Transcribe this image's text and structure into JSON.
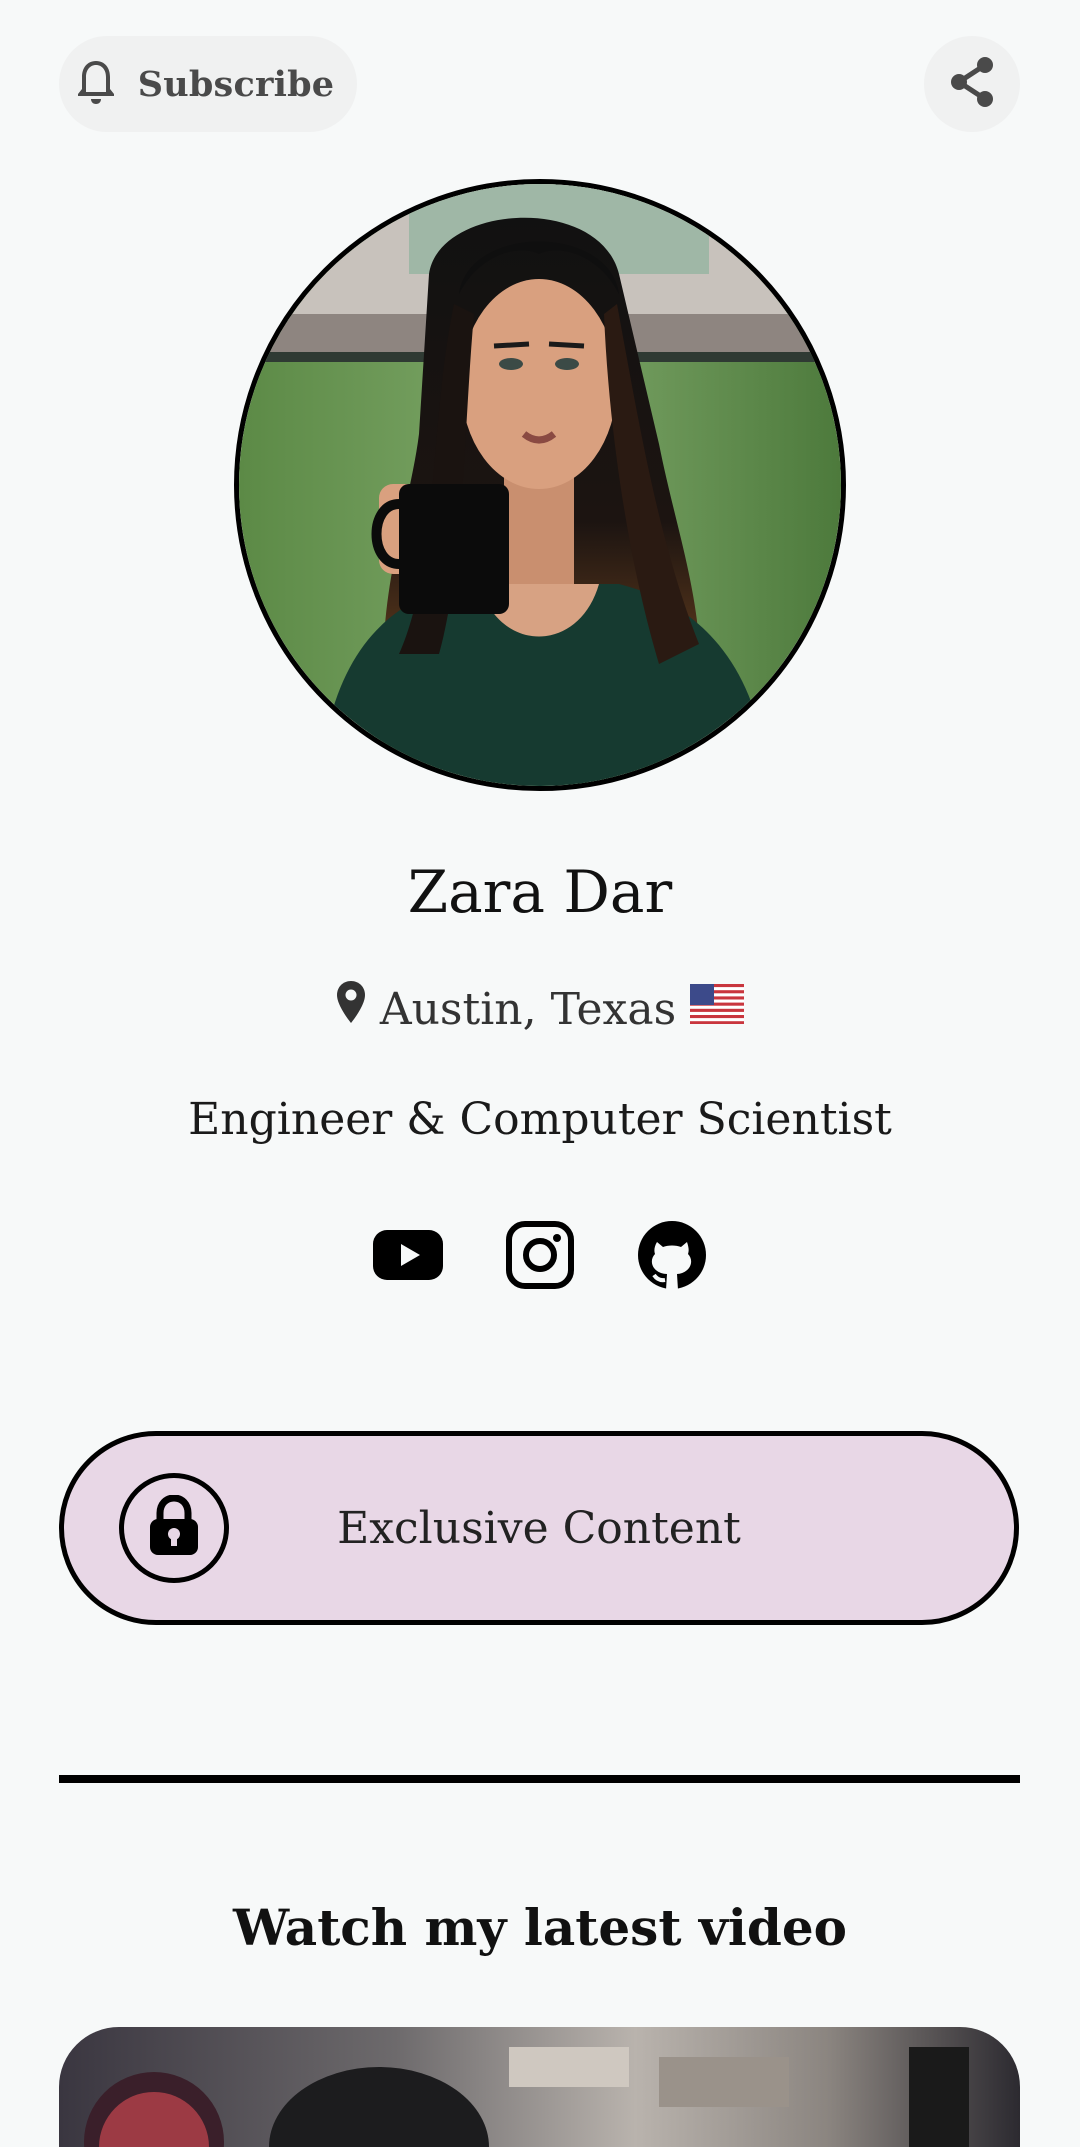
{
  "header": {
    "subscribe_label": "Subscribe",
    "subscribe_icon": "bell-icon",
    "share_icon": "share-icon"
  },
  "profile": {
    "name": "Zara Dar",
    "location": "Austin, Texas",
    "location_flag": "🇺🇸",
    "bio": "Engineer & Computer Scientist",
    "avatar_description": "profile photo"
  },
  "socials": [
    {
      "icon": "youtube-icon"
    },
    {
      "icon": "instagram-icon"
    },
    {
      "icon": "github-icon"
    }
  ],
  "exclusive": {
    "label": "Exclusive Content",
    "icon": "lock-icon",
    "background": "#e8d7e6"
  },
  "latest_video": {
    "title": "Watch my latest video"
  },
  "colors": {
    "page_bg": "#f7f9f9",
    "button_bg": "#f0f1f1",
    "accent_border": "#000000"
  }
}
